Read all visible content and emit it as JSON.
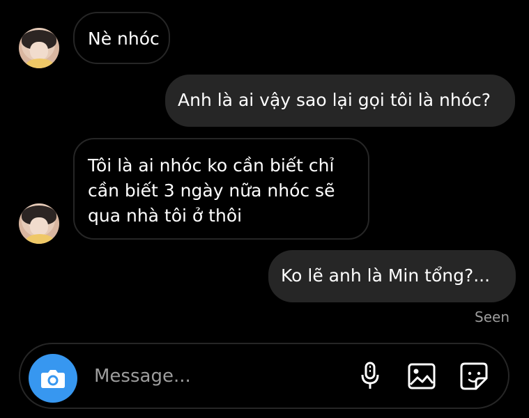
{
  "conversation": {
    "messages": [
      {
        "sender": "other",
        "text": "Nè nhóc"
      },
      {
        "sender": "me",
        "text": "Anh là ai vậy sao lại gọi tôi là nhóc?"
      },
      {
        "sender": "other",
        "lines": [
          "Tôi là ai nhóc ko cần biết chỉ",
          "cần biết 3 ngày nữa nhóc sẽ",
          "qua nhà tôi ở thôi"
        ]
      },
      {
        "sender": "me",
        "text": "Ko lẽ anh là Min tổng?..."
      }
    ],
    "seen_label": "Seen"
  },
  "composer": {
    "placeholder": "Message...",
    "icons": {
      "camera": "camera-icon",
      "microphone": "microphone-icon",
      "gallery": "image-icon",
      "sticker": "sticker-icon"
    }
  },
  "colors": {
    "background": "#000000",
    "outgoing_bubble": "#262626",
    "incoming_border": "#262626",
    "accent": "#3797f0",
    "muted_text": "#9d9d9d"
  }
}
